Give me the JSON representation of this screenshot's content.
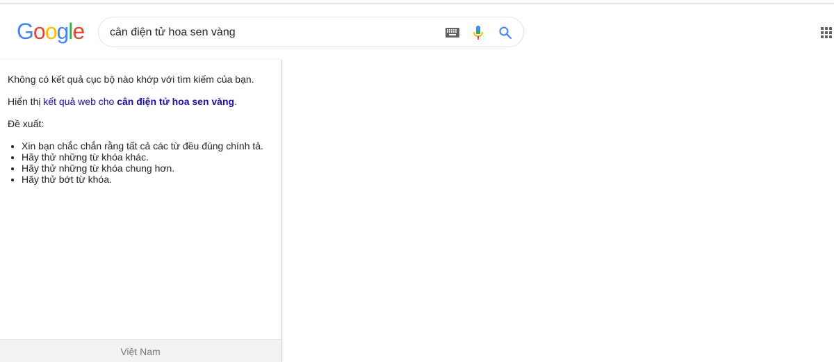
{
  "logo": {
    "letters": [
      "G",
      "o",
      "o",
      "g",
      "l",
      "e"
    ],
    "colors": [
      "#4285f4",
      "#ea4335",
      "#fbbc05",
      "#4285f4",
      "#34a853",
      "#ea4335"
    ]
  },
  "search": {
    "query": "cân điện tử hoa sen vàng",
    "icons": [
      "keyboard-icon",
      "mic-icon",
      "search-icon"
    ]
  },
  "header": {
    "apps_icon": "apps-grid-icon"
  },
  "panel": {
    "no_results": "Không có kết quả cục bộ nào khớp với tìm kiếm của bạn.",
    "web_prefix": "Hiển thị ",
    "web_link": "kết quả web cho ",
    "web_query": "cân điện tử hoa sen vàng",
    "web_suffix": ".",
    "suggest_title": "Đề xuất:",
    "suggestions": [
      "Xin bạn chắc chắn rằng tất cả các từ đều đúng chính tả.",
      "Hãy thử những từ khóa khác.",
      "Hãy thử những từ khóa chung hơn.",
      "Hãy thử bớt từ khóa."
    ],
    "footer": "Việt Nam"
  },
  "colors": {
    "link": "#1a0dab",
    "border": "#dfe1e5",
    "footer_bg": "#f2f2f2"
  }
}
